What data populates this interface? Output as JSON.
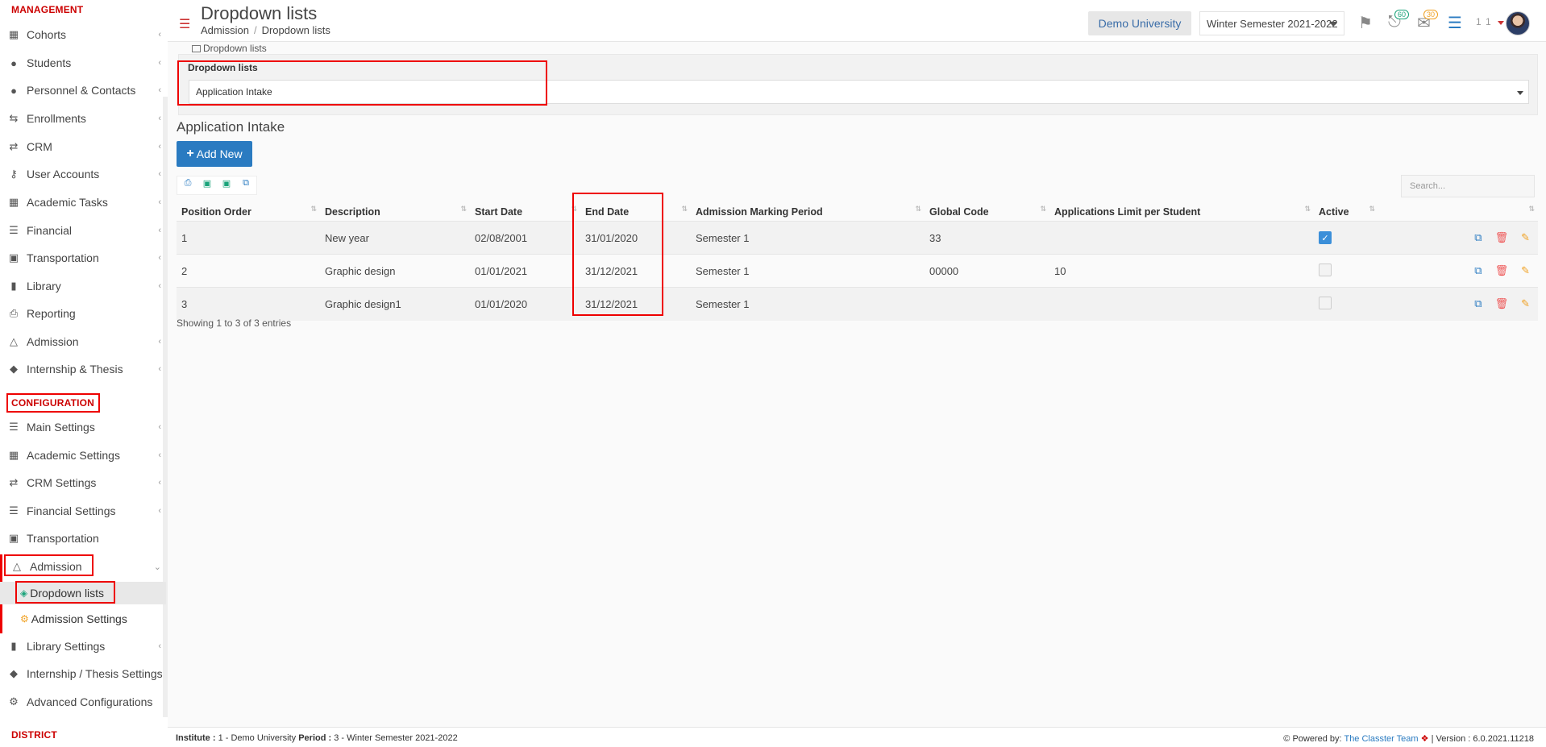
{
  "sidebar": {
    "management_title": "MANAGEMENT",
    "management_items": [
      {
        "label": "Cohorts",
        "icon": "users-grid-icon"
      },
      {
        "label": "Students",
        "icon": "students-icon"
      },
      {
        "label": "Personnel & Contacts",
        "icon": "person-icon"
      },
      {
        "label": "Enrollments",
        "icon": "arrows-icon"
      },
      {
        "label": "CRM",
        "icon": "shuffle-icon"
      },
      {
        "label": "User Accounts",
        "icon": "key-icon"
      },
      {
        "label": "Academic Tasks",
        "icon": "grid-icon"
      },
      {
        "label": "Financial",
        "icon": "coins-icon"
      },
      {
        "label": "Transportation",
        "icon": "bus-icon"
      },
      {
        "label": "Library",
        "icon": "books-icon"
      },
      {
        "label": "Reporting",
        "icon": "printer-icon"
      },
      {
        "label": "Admission",
        "icon": "institution-icon"
      },
      {
        "label": "Internship & Thesis",
        "icon": "cube-icon"
      }
    ],
    "configuration_title": "CONFIGURATION",
    "configuration_items": [
      {
        "label": "Main Settings",
        "icon": "sliders-icon"
      },
      {
        "label": "Academic Settings",
        "icon": "users-grid-icon"
      },
      {
        "label": "CRM Settings",
        "icon": "shuffle-icon"
      },
      {
        "label": "Financial Settings",
        "icon": "coins-icon"
      },
      {
        "label": "Transportation",
        "icon": "bus-icon"
      },
      {
        "label": "Admission",
        "icon": "institution-icon"
      }
    ],
    "admission_sub": [
      {
        "label": "Dropdown lists",
        "icon": "layers-icon"
      },
      {
        "label": "Admission Settings",
        "icon": "gear-icon"
      }
    ],
    "configuration_items_after": [
      {
        "label": "Library Settings",
        "icon": "books-icon"
      },
      {
        "label": "Internship / Thesis Settings",
        "icon": "cube-icon"
      },
      {
        "label": "Advanced Configurations",
        "icon": "gears-icon"
      }
    ],
    "district_title": "DISTRICT"
  },
  "header": {
    "title": "Dropdown lists",
    "breadcrumb": [
      "Admission",
      "Dropdown lists"
    ],
    "university": "Demo University",
    "semester": "Winter Semester 2021-2022",
    "notifications_count": "60",
    "messages_count": "30",
    "user_nums": "1 1"
  },
  "main": {
    "tab_label": "Dropdown lists",
    "panel_label": "Dropdown lists",
    "selected_list": "Application Intake",
    "section_title": "Application Intake",
    "add_button": "Add New",
    "search_placeholder": "Search...",
    "columns": [
      "Position Order",
      "Description",
      "Start Date",
      "End Date",
      "Admission Marking Period",
      "Global Code",
      "Applications Limit per Student",
      "Active",
      ""
    ],
    "rows": [
      {
        "order": "1",
        "description": "New year",
        "start": "02/08/2001",
        "end": "31/01/2020",
        "period": "Semester 1",
        "code": "33",
        "limit": "",
        "active": true
      },
      {
        "order": "2",
        "description": "Graphic design",
        "start": "01/01/2021",
        "end": "31/12/2021",
        "period": "Semester 1",
        "code": "00000",
        "limit": "10",
        "active": false
      },
      {
        "order": "3",
        "description": "Graphic design1",
        "start": "01/01/2020",
        "end": "31/12/2021",
        "period": "Semester 1",
        "code": "",
        "limit": "",
        "active": false
      }
    ],
    "info": "Showing 1 to 3 of 3 entries"
  },
  "footer": {
    "institute_label": "Institute :",
    "institute_value": "1 - Demo University",
    "period_label": "Period :",
    "period_value": "3 - Winter Semester 2021-2022",
    "powered_label": "Powered by:",
    "powered_link": "The Classter Team",
    "version": "| Version : 6.0.2021.11218"
  },
  "colors": {
    "accent": "#2a7bc1",
    "highlight": "#e00000",
    "brand_red": "#c00000"
  }
}
